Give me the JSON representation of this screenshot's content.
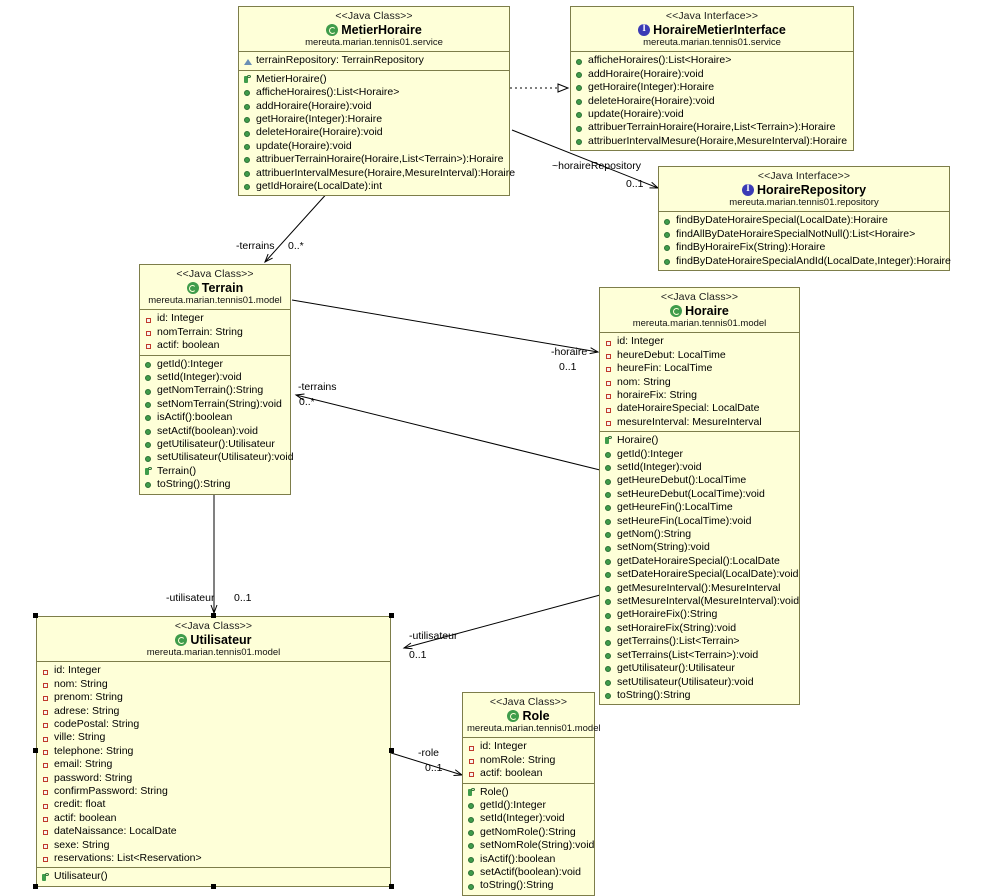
{
  "diagram": {
    "title": "UML Class Diagram",
    "colors": {
      "box_fill": "#feffd8",
      "box_border": "#7d7d4a",
      "class_icon": "#3f9c4b",
      "interface_icon": "#3b3bb5",
      "attribute_marker": "#c0392b",
      "method_marker": "#3f9c4b",
      "package_marker": "#6a8fb5",
      "line": "#000000",
      "background": "#ffffff"
    }
  },
  "classes": {
    "metier_horaire": {
      "stereotype": "<<Java Class>>",
      "name": "MetierHoraire",
      "package": "mereuta.marian.tennis01.service",
      "icon": "class-icon",
      "attributes": [
        {
          "marker": "pkgattr",
          "text": "terrainRepository: TerrainRepository"
        }
      ],
      "methods": [
        {
          "marker": "ctor",
          "text": "MetierHoraire()"
        },
        {
          "marker": "meth",
          "text": "afficheHoraires():List<Horaire>"
        },
        {
          "marker": "meth",
          "text": "addHoraire(Horaire):void"
        },
        {
          "marker": "meth",
          "text": "getHoraire(Integer):Horaire"
        },
        {
          "marker": "meth",
          "text": "deleteHoraire(Horaire):void"
        },
        {
          "marker": "meth",
          "text": "update(Horaire):void"
        },
        {
          "marker": "meth",
          "text": "attribuerTerrainHoraire(Horaire,List<Terrain>):Horaire"
        },
        {
          "marker": "meth",
          "text": "attribuerIntervalMesure(Horaire,MesureInterval):Horaire"
        },
        {
          "marker": "meth",
          "text": "getIdHoraire(LocalDate):int"
        }
      ]
    },
    "horaire_metier_interface": {
      "stereotype": "<<Java Interface>>",
      "name": "HoraireMetierInterface",
      "package": "mereuta.marian.tennis01.service",
      "icon": "interface-icon",
      "attributes": [],
      "methods": [
        {
          "marker": "meth",
          "text": "afficheHoraires():List<Horaire>"
        },
        {
          "marker": "meth",
          "text": "addHoraire(Horaire):void"
        },
        {
          "marker": "meth",
          "text": "getHoraire(Integer):Horaire"
        },
        {
          "marker": "meth",
          "text": "deleteHoraire(Horaire):void"
        },
        {
          "marker": "meth",
          "text": "update(Horaire):void"
        },
        {
          "marker": "meth",
          "text": "attribuerTerrainHoraire(Horaire,List<Terrain>):Horaire"
        },
        {
          "marker": "meth",
          "text": "attribuerIntervalMesure(Horaire,MesureInterval):Horaire"
        }
      ]
    },
    "horaire_repository": {
      "stereotype": "<<Java Interface>>",
      "name": "HoraireRepository",
      "package": "mereuta.marian.tennis01.repository",
      "icon": "interface-icon",
      "attributes": [],
      "methods": [
        {
          "marker": "meth",
          "text": "findByDateHoraireSpecial(LocalDate):Horaire"
        },
        {
          "marker": "meth",
          "text": "findAllByDateHoraireSpecialNotNull():List<Horaire>"
        },
        {
          "marker": "meth",
          "text": "findByHoraireFix(String):Horaire"
        },
        {
          "marker": "meth",
          "text": "findByDateHoraireSpecialAndId(LocalDate,Integer):Horaire"
        }
      ]
    },
    "terrain": {
      "stereotype": "<<Java Class>>",
      "name": "Terrain",
      "package": "mereuta.marian.tennis01.model",
      "icon": "class-icon",
      "attributes": [
        {
          "marker": "attr",
          "text": "id: Integer"
        },
        {
          "marker": "attr",
          "text": "nomTerrain: String"
        },
        {
          "marker": "attr",
          "text": "actif: boolean"
        }
      ],
      "methods": [
        {
          "marker": "meth",
          "text": "getId():Integer"
        },
        {
          "marker": "meth",
          "text": "setId(Integer):void"
        },
        {
          "marker": "meth",
          "text": "getNomTerrain():String"
        },
        {
          "marker": "meth",
          "text": "setNomTerrain(String):void"
        },
        {
          "marker": "meth",
          "text": "isActif():boolean"
        },
        {
          "marker": "meth",
          "text": "setActif(boolean):void"
        },
        {
          "marker": "meth",
          "text": "getUtilisateur():Utilisateur"
        },
        {
          "marker": "meth",
          "text": "setUtilisateur(Utilisateur):void"
        },
        {
          "marker": "ctor",
          "text": "Terrain()"
        },
        {
          "marker": "meth",
          "text": "toString():String"
        }
      ]
    },
    "horaire": {
      "stereotype": "<<Java Class>>",
      "name": "Horaire",
      "package": "mereuta.marian.tennis01.model",
      "icon": "class-icon",
      "attributes": [
        {
          "marker": "attr",
          "text": "id: Integer"
        },
        {
          "marker": "attr",
          "text": "heureDebut: LocalTime"
        },
        {
          "marker": "attr",
          "text": "heureFin: LocalTime"
        },
        {
          "marker": "attr",
          "text": "nom: String"
        },
        {
          "marker": "attr",
          "text": "horaireFix: String"
        },
        {
          "marker": "attr",
          "text": "dateHoraireSpecial: LocalDate"
        },
        {
          "marker": "attr",
          "text": "mesureInterval: MesureInterval"
        }
      ],
      "methods": [
        {
          "marker": "ctor",
          "text": "Horaire()"
        },
        {
          "marker": "meth",
          "text": "getId():Integer"
        },
        {
          "marker": "meth",
          "text": "setId(Integer):void"
        },
        {
          "marker": "meth",
          "text": "getHeureDebut():LocalTime"
        },
        {
          "marker": "meth",
          "text": "setHeureDebut(LocalTime):void"
        },
        {
          "marker": "meth",
          "text": "getHeureFin():LocalTime"
        },
        {
          "marker": "meth",
          "text": "setHeureFin(LocalTime):void"
        },
        {
          "marker": "meth",
          "text": "getNom():String"
        },
        {
          "marker": "meth",
          "text": "setNom(String):void"
        },
        {
          "marker": "meth",
          "text": "getDateHoraireSpecial():LocalDate"
        },
        {
          "marker": "meth",
          "text": "setDateHoraireSpecial(LocalDate):void"
        },
        {
          "marker": "meth",
          "text": "getMesureInterval():MesureInterval"
        },
        {
          "marker": "meth",
          "text": "setMesureInterval(MesureInterval):void"
        },
        {
          "marker": "meth",
          "text": "getHoraireFix():String"
        },
        {
          "marker": "meth",
          "text": "setHoraireFix(String):void"
        },
        {
          "marker": "meth",
          "text": "getTerrains():List<Terrain>"
        },
        {
          "marker": "meth",
          "text": "setTerrains(List<Terrain>):void"
        },
        {
          "marker": "meth",
          "text": "getUtilisateur():Utilisateur"
        },
        {
          "marker": "meth",
          "text": "setUtilisateur(Utilisateur):void"
        },
        {
          "marker": "meth",
          "text": "toString():String"
        }
      ]
    },
    "utilisateur": {
      "stereotype": "<<Java Class>>",
      "name": "Utilisateur",
      "package": "mereuta.marian.tennis01.model",
      "icon": "class-icon",
      "selected": true,
      "attributes": [
        {
          "marker": "attr",
          "text": "id: Integer"
        },
        {
          "marker": "attr",
          "text": "nom: String"
        },
        {
          "marker": "attr",
          "text": "prenom: String"
        },
        {
          "marker": "attr",
          "text": "adrese: String"
        },
        {
          "marker": "attr",
          "text": "codePostal: String"
        },
        {
          "marker": "attr",
          "text": "ville: String"
        },
        {
          "marker": "attr",
          "text": "telephone: String"
        },
        {
          "marker": "attr",
          "text": "email: String"
        },
        {
          "marker": "attr",
          "text": "password: String"
        },
        {
          "marker": "attr",
          "text": "confirmPassword: String"
        },
        {
          "marker": "attr",
          "text": "credit: float"
        },
        {
          "marker": "attr",
          "text": "actif: boolean"
        },
        {
          "marker": "attr",
          "text": "dateNaissance: LocalDate"
        },
        {
          "marker": "attr",
          "text": "sexe: String"
        },
        {
          "marker": "attr",
          "text": "reservations: List<Reservation>"
        }
      ],
      "methods": [
        {
          "marker": "ctor",
          "text": "Utilisateur()"
        }
      ]
    },
    "role": {
      "stereotype": "<<Java Class>>",
      "name": "Role",
      "package": "mereuta.marian.tennis01.model",
      "icon": "class-icon",
      "attributes": [
        {
          "marker": "attr",
          "text": "id: Integer"
        },
        {
          "marker": "attr",
          "text": "nomRole: String"
        },
        {
          "marker": "attr",
          "text": "actif: boolean"
        }
      ],
      "methods": [
        {
          "marker": "ctor",
          "text": "Role()"
        },
        {
          "marker": "meth",
          "text": "getId():Integer"
        },
        {
          "marker": "meth",
          "text": "setId(Integer):void"
        },
        {
          "marker": "meth",
          "text": "getNomRole():String"
        },
        {
          "marker": "meth",
          "text": "setNomRole(String):void"
        },
        {
          "marker": "meth",
          "text": "isActif():boolean"
        },
        {
          "marker": "meth",
          "text": "setActif(boolean):void"
        },
        {
          "marker": "meth",
          "text": "toString():String"
        }
      ]
    }
  },
  "edges": [
    {
      "id": "terrains_from_metier",
      "role_label": "-terrains",
      "multiplicity": "0..*"
    },
    {
      "id": "horaire_repo",
      "role_label": "~horaireRepository",
      "multiplicity": "0..1"
    },
    {
      "id": "terrains_from_horaire",
      "role_label": "-terrains",
      "multiplicity": "0..*"
    },
    {
      "id": "horaire_from_terrain",
      "role_label": "-horaire",
      "multiplicity": "0..1"
    },
    {
      "id": "utilisateur_from_terrain",
      "role_label": "-utilisateur",
      "multiplicity": "0..1"
    },
    {
      "id": "utilisateur_from_horaire",
      "role_label": "-utilisateur",
      "multiplicity": "0..1"
    },
    {
      "id": "role_from_utilisateur",
      "role_label": "-role",
      "multiplicity": "0..1"
    }
  ]
}
